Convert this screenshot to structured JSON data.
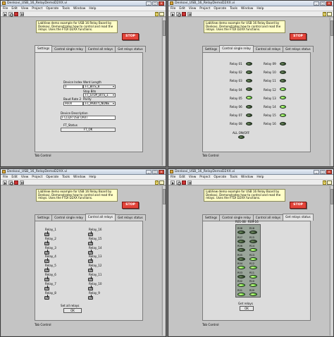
{
  "window": {
    "title": "Denkovi_USB_16_RelayDemoD2XX.vi",
    "menu": [
      "File",
      "Edit",
      "View",
      "Project",
      "Operate",
      "Tools",
      "Window",
      "Help"
    ],
    "help_glyph": "?"
  },
  "description": "LabView demo example for USB 16 Relay Board by Denkovi. Demonstrates how to control and read the relays. Uses the FTDI D2XX functions.",
  "stop_label": "STOP",
  "tabs": [
    "Settings",
    "Control single relay",
    "Control all relays",
    "Get relays status"
  ],
  "tab_control_label": "Tab Control",
  "settings": {
    "device_index_label": "Device Index",
    "device_index_value": "0",
    "baud_rate_label": "Baud Rate 2",
    "baud_rate_value": "9600",
    "word_length_label": "Word Length",
    "word_length_value": "FT_BITS_8",
    "stop_bits_label": "Stop Bits",
    "stop_bits_value": "FT_STOP_BITS_1",
    "parity_label": "Parity",
    "parity_value": "FT_PARITY_NONE",
    "device_description_label": "Device Description",
    "device_description_value": "FT232R USB UART",
    "ft_status_label": "FT_Status",
    "ft_status_value": "FT_OK"
  },
  "single_relay": {
    "left": [
      {
        "label": "Relay 01",
        "on": false
      },
      {
        "label": "Relay 02",
        "on": false
      },
      {
        "label": "Relay 03",
        "on": false
      },
      {
        "label": "Relay 04",
        "on": false
      },
      {
        "label": "Relay 05",
        "on": true
      },
      {
        "label": "Relay 06",
        "on": false
      },
      {
        "label": "Relay 07",
        "on": false
      },
      {
        "label": "Relay 08",
        "on": false
      }
    ],
    "right": [
      {
        "label": "Relay 09",
        "on": false
      },
      {
        "label": "Relay 10",
        "on": false
      },
      {
        "label": "Relay 11",
        "on": false
      },
      {
        "label": "Relay 12",
        "on": true
      },
      {
        "label": "Relay 13",
        "on": true
      },
      {
        "label": "Relay 14",
        "on": true
      },
      {
        "label": "Relay 15",
        "on": true
      },
      {
        "label": "Relay 16",
        "on": false
      }
    ],
    "all_label": "ALL ON/OFF"
  },
  "all_relays": {
    "left": [
      "Relay_1",
      "Relay_2",
      "Relay_3",
      "Relay_4",
      "Relay_5",
      "Relay_6",
      "Relay_7",
      "Relay_8"
    ],
    "right": [
      "Relay_16",
      "Relay_15",
      "Relay_14",
      "Relay_13",
      "Relay_12",
      "Relay_11",
      "Relay_10",
      "Relay_9"
    ],
    "set_label": "Set all relays",
    "ok_label": "OK"
  },
  "status": {
    "col_left_label": "R01-08",
    "col_right_label": "R09-16",
    "left": [
      {
        "label": "R08",
        "on": false
      },
      {
        "label": "R07",
        "on": false
      },
      {
        "label": "R06",
        "on": false
      },
      {
        "label": "R05",
        "on": false
      },
      {
        "label": "R04",
        "on": true
      },
      {
        "label": "R03",
        "on": false
      },
      {
        "label": "R02",
        "on": true
      },
      {
        "label": "R01",
        "on": true
      }
    ],
    "right": [
      {
        "label": "R16",
        "on": false
      },
      {
        "label": "R15",
        "on": false
      },
      {
        "label": "R14",
        "on": true
      },
      {
        "label": "R13",
        "on": true
      },
      {
        "label": "R12",
        "on": true
      },
      {
        "label": "R11",
        "on": true
      },
      {
        "label": "R10",
        "on": true
      },
      {
        "label": "R09",
        "on": true
      }
    ],
    "get_label": "Get relays",
    "ok_label": "OK"
  }
}
